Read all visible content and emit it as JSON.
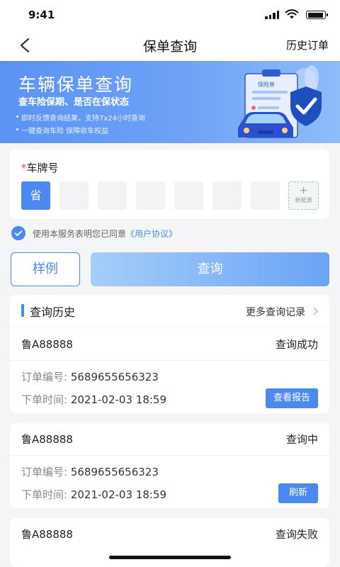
{
  "status_bar": {
    "time": "9:41"
  },
  "nav": {
    "title": "保单查询",
    "history_orders": "历史订单"
  },
  "banner": {
    "title": "车辆保单查询",
    "subtitle": "查车险保期、是否在保状态",
    "bullets": [
      "即时反馈查询结果，支持7x24小时查询",
      "一键查询车险 保障收车权益"
    ],
    "doc_label": "保险单"
  },
  "plate": {
    "required_mark": "*",
    "label": "车牌号",
    "province": "省",
    "nev_plus": "+",
    "nev_label": "新能源"
  },
  "agreement": {
    "prefix": "使用本服务表明您已同意",
    "link": "《用户协议》"
  },
  "buttons": {
    "sample": "样例",
    "query": "查询"
  },
  "history": {
    "title": "查询历史",
    "more": "更多查询记录",
    "order_no_label": "订单编号: ",
    "order_time_label": "下单时间: ",
    "records": [
      {
        "plate": "鲁A88888",
        "status": "查询成功",
        "order_no": "5689655656323",
        "order_time": "2021-02-03 18:59",
        "action": "查看报告"
      },
      {
        "plate": "鲁A88888",
        "status": "查询中",
        "order_no": "5689655656323",
        "order_time": "2021-02-03 18:59",
        "action": "刷新"
      },
      {
        "plate": "鲁A88888",
        "status": "查询失败"
      }
    ]
  },
  "colors": {
    "accent": "#4b89f2",
    "required": "#e64b3b",
    "nev_border": "#8fd19a"
  }
}
